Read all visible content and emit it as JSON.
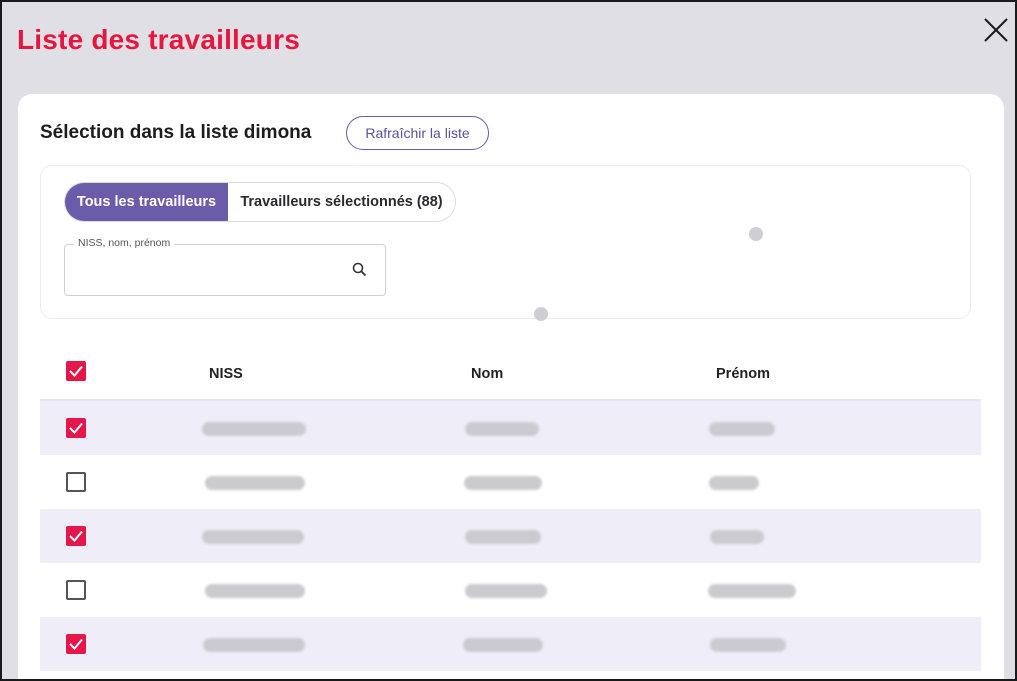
{
  "modal": {
    "title": "Liste des travailleurs",
    "close_icon": "close-icon"
  },
  "section": {
    "title": "Sélection dans la liste dimona",
    "refresh_label": "Rafraîchir la liste"
  },
  "filter": {
    "tabs": [
      {
        "label": "Tous les travailleurs",
        "active": true
      },
      {
        "label": "Travailleurs sélectionnés (88)",
        "active": false
      }
    ],
    "search": {
      "label": "NISS, nom, prénom",
      "placeholder": "",
      "value": "",
      "icon": "search-icon"
    }
  },
  "table": {
    "headers": {
      "select_all_checked": true,
      "niss": "NISS",
      "nom": "Nom",
      "prenom": "Prénom"
    },
    "rows": [
      {
        "checked": true
      },
      {
        "checked": false
      },
      {
        "checked": true
      },
      {
        "checked": false
      },
      {
        "checked": true
      }
    ]
  },
  "colors": {
    "title_red": "#e5173f",
    "accent_purple": "#6a5ca8",
    "checkbox_red": "#e5174a",
    "selected_row": "#efeef8",
    "overlay_gray": "#dfdfe5"
  }
}
